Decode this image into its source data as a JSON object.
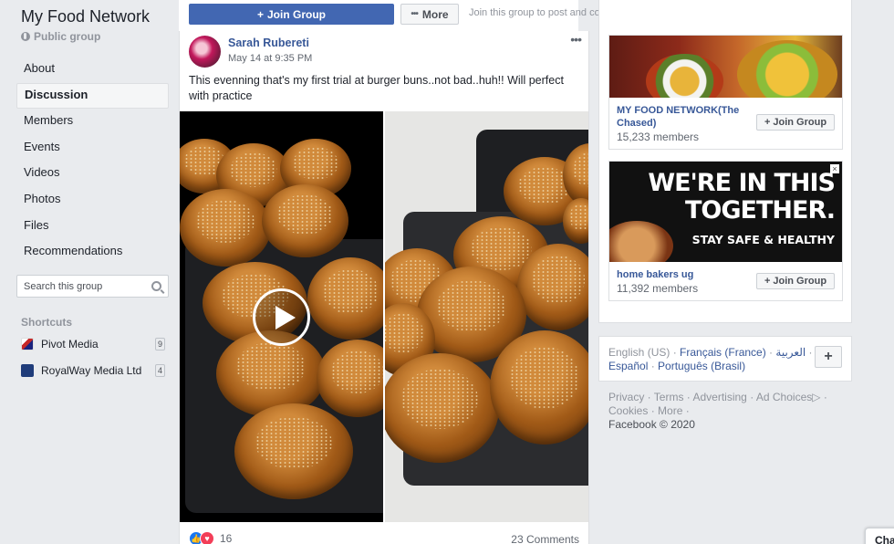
{
  "group": {
    "name": "My Food Network",
    "privacy": "Public group"
  },
  "nav": [
    "About",
    "Discussion",
    "Members",
    "Events",
    "Videos",
    "Photos",
    "Files",
    "Recommendations"
  ],
  "nav_active": "Discussion",
  "search": {
    "placeholder": "Search this group"
  },
  "shortcuts": {
    "heading": "Shortcuts",
    "items": [
      {
        "name": "Pivot Media",
        "count": "9"
      },
      {
        "name": "RoyalWay Media Ltd",
        "count": "4"
      }
    ]
  },
  "toolbar": {
    "join_label": "Join Group",
    "more_label": "More",
    "hint": "Join this group to post and comment."
  },
  "post": {
    "author": "Sarah Rubereti",
    "time": "May 14 at 9:35 PM",
    "text": "This evenning that's my first trial at burger buns..not bad..huh!! Will perfect with practice",
    "reaction_count": "16",
    "comments": "23 Comments"
  },
  "suggested": [
    {
      "name": "MY FOOD NETWORK(The Chased)",
      "members": "15,233 members",
      "join_label": "Join Group"
    },
    {
      "name": "home bakers ug",
      "members": "11,392 members",
      "join_label": "Join Group",
      "ad_lines": [
        "WE'RE IN THIS",
        "TOGETHER.",
        "STAY SAFE & HEALTHY"
      ]
    }
  ],
  "languages": {
    "current": "English (US)",
    "links": [
      "Français (France)",
      "العربية",
      "Español",
      "Português (Brasil)"
    ],
    "plus": "+"
  },
  "footer": {
    "links": [
      "Privacy",
      "Terms",
      "Advertising",
      "Ad Choices",
      "Cookies",
      "More"
    ],
    "copyright": "Facebook © 2020"
  },
  "chat_label": "Cha",
  "colors": {
    "brand": "#4267b2",
    "link": "#385898",
    "background": "#e9ebee"
  }
}
